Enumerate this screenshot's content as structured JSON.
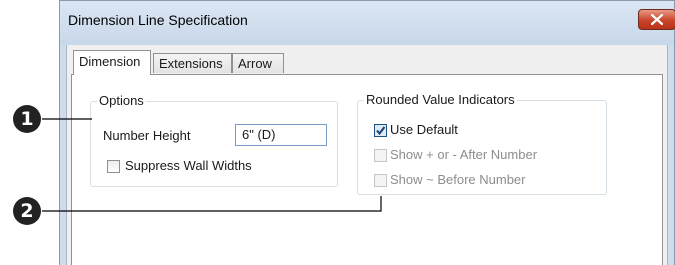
{
  "window": {
    "title": "Dimension Line Specification"
  },
  "tabs": [
    {
      "label": "Dimension",
      "active": true
    },
    {
      "label": "Extensions",
      "active": false
    },
    {
      "label": "Arrow",
      "active": false
    }
  ],
  "options_group": {
    "legend": "Options",
    "number_height_label": "Number Height",
    "number_height_value": "6\" (D)",
    "suppress_wall_widths_label": "Suppress Wall Widths",
    "suppress_wall_widths_checked": false
  },
  "rounded_group": {
    "legend": "Rounded Value Indicators",
    "use_default_label": "Use Default",
    "use_default_checked": true,
    "show_plus_minus_label": "Show + or - After Number",
    "show_plus_minus_checked": false,
    "show_tilde_label": "Show ~ Before Number",
    "show_tilde_checked": false
  },
  "callouts": {
    "one": "1",
    "two": "2"
  },
  "colors": {
    "title_bar": "#cfdcec",
    "close_button": "#c9442a",
    "callout": "#222222",
    "disabled_text": "#8d8d8d"
  }
}
